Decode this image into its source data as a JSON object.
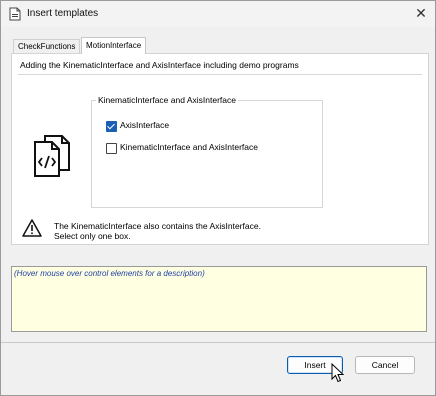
{
  "window": {
    "title": "Insert templates",
    "close_glyph": "✕"
  },
  "tabs": [
    {
      "label": "CheckFunctions",
      "selected": false
    },
    {
      "label": "MotionInterface",
      "selected": true
    }
  ],
  "panel": {
    "description": "Adding the KinematicInterface and AxisInterface including demo programs",
    "group_title": "KinematicInterface and AxisInterface",
    "options": [
      {
        "label": "AxisInterface",
        "checked": true
      },
      {
        "label": "KinematicInterface and AxisInterface",
        "checked": false
      }
    ],
    "warning_line1": "The KinematicInterface also contains the AxisInterface.",
    "warning_line2": "Select only one box."
  },
  "hint": "(Hover mouse over control elements for a description)",
  "buttons": {
    "insert": "Insert",
    "cancel": "Cancel"
  },
  "colors": {
    "accent": "#1a5fb4",
    "hint_bg": "#ffffe1",
    "hint_text": "#1f3fa8"
  },
  "icons": [
    "template-file-icon",
    "close-icon",
    "code-files-icon",
    "warning-icon",
    "cursor-icon"
  ]
}
